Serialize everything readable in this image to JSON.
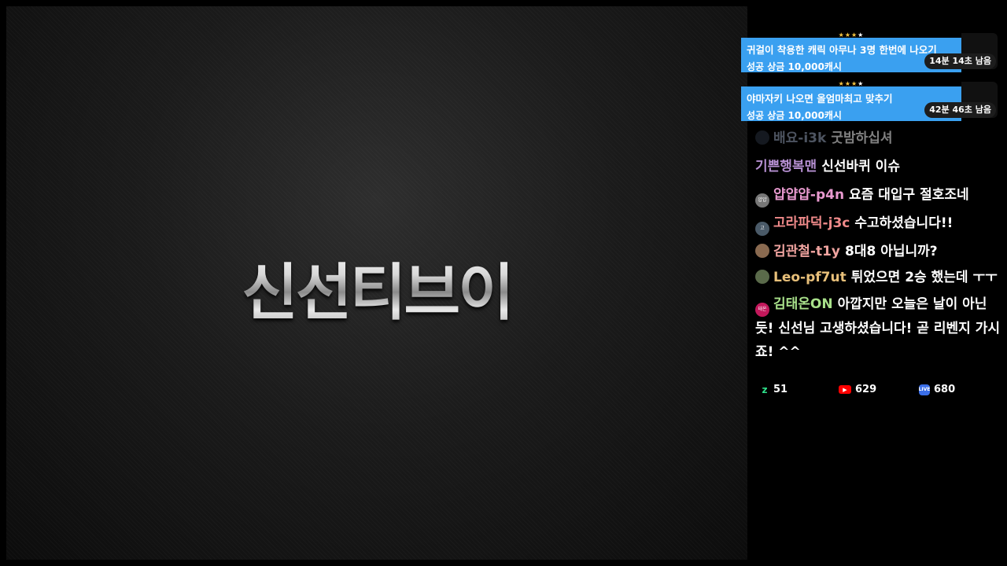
{
  "stream": {
    "logo_text": "신선티브이"
  },
  "missions": [
    {
      "title": "귀걸이 착용한 캐릭 아무나 3명 한번에 나오기",
      "reward": "성공 상금 10,000캐시",
      "timer": "14분 14초 남음",
      "stars_on": "★★★",
      "stars_off": "★"
    },
    {
      "title": "야마자키 나오면 올엄마최고 맞추기",
      "reward": "성공 상금 10,000캐시",
      "timer": "42분 46초 남음",
      "stars_on": "★★★",
      "stars_off": "★"
    }
  ],
  "chat": [
    {
      "nick": "배요-i3k",
      "text": "굿밤하십셔",
      "avatar": ""
    },
    {
      "nick": "기쁜행복맨",
      "text": "신선바퀴 이슈",
      "avatar": ""
    },
    {
      "nick": "얍얍얍-p4n",
      "text": "요즘 대입구 절호조네",
      "avatar": "얍얍"
    },
    {
      "nick": "고라파덕-j3c",
      "text": "수고하셨습니다!!",
      "avatar": "고"
    },
    {
      "nick": "김관철-t1y",
      "text": "8대8 아닙니까?",
      "avatar": ""
    },
    {
      "nick": "Leo-pf7ut",
      "text": "튀었으면 2승 했는데 ㅜㅜ",
      "avatar": ""
    },
    {
      "nick": "김태온ON",
      "text": "아깝지만 오늘은 날이 아닌듯! 신선님 고생하셨습니다! 곧 리벤지 가시죠! ^^",
      "avatar": "태온"
    }
  ],
  "stats": [
    {
      "icon": "z",
      "value": "51"
    },
    {
      "icon": "▶",
      "value": "629"
    },
    {
      "icon": "live",
      "value": "680"
    }
  ],
  "colors": {
    "mission_bg": "#3aa0f0",
    "nick_1": "#9aa7c0",
    "nick_2": "#b58fd1",
    "nick_3": "#e99ad0",
    "nick_4": "#f08a8a",
    "nick_5": "#f0a4a0",
    "nick_6": "#e8c07a",
    "nick_7": "#a8e08a"
  }
}
